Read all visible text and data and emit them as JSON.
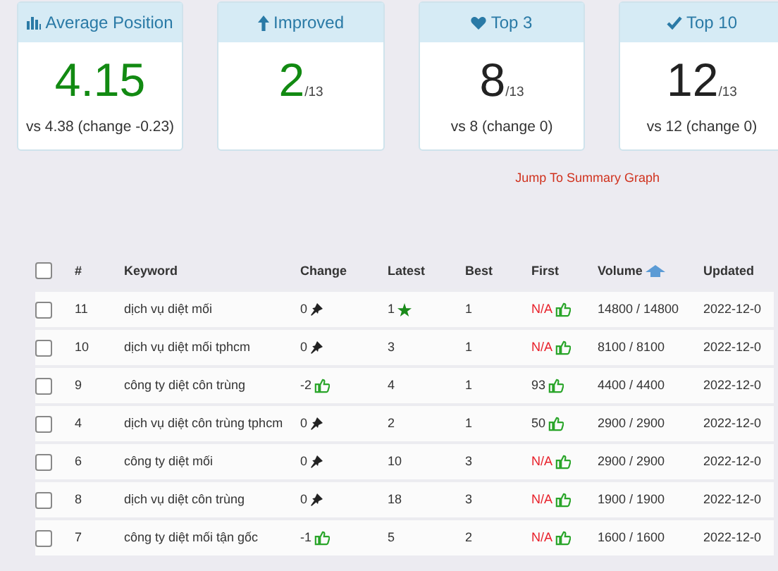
{
  "cards": [
    {
      "title": "Average Position",
      "value": "4.15",
      "color": "#128a12",
      "footer": "vs 4.38 (change -0.23)"
    },
    {
      "title": "Improved",
      "value": "2",
      "suffix": "/13",
      "color": "#128a12"
    },
    {
      "title": "Top 3",
      "value": "8",
      "suffix": "/13",
      "color": "#222222",
      "footer": "vs 8 (change 0)"
    },
    {
      "title": "Top 10",
      "value": "12",
      "suffix": "/13",
      "color": "#222222",
      "footer": "vs 12 (change 0)"
    }
  ],
  "summary_link": "Jump To Summary Graph",
  "table": {
    "select_all_checked": false,
    "columns": [
      "#",
      "Keyword",
      "Change",
      "Latest",
      "Best",
      "First",
      "Volume",
      "Updated"
    ],
    "rows": [
      {
        "checked": false,
        "num": "11",
        "keyword": "dịch vụ diệt mối",
        "change": "0",
        "kind": "pin",
        "latest": "1",
        "latest_star": true,
        "best": "1",
        "first": "N/A",
        "first_missing": true,
        "volume": "14800 / 14800",
        "updated": "2022-12-0"
      },
      {
        "checked": false,
        "num": "10",
        "keyword": "dịch vụ diệt mối tphcm",
        "change": "0",
        "kind": "pin",
        "latest": "3",
        "latest_star": false,
        "best": "1",
        "first": "N/A",
        "first_missing": true,
        "volume": "8100 / 8100",
        "updated": "2022-12-0"
      },
      {
        "checked": false,
        "num": "9",
        "keyword": "công ty diệt côn trùng",
        "change": "-2",
        "kind": "up",
        "latest": "4",
        "latest_star": false,
        "best": "1",
        "first": "93",
        "first_missing": false,
        "volume": "4400 / 4400",
        "updated": "2022-12-0"
      },
      {
        "checked": false,
        "num": "4",
        "keyword": "dịch vụ diệt côn trùng tphcm",
        "change": "0",
        "kind": "pin",
        "latest": "2",
        "latest_star": false,
        "best": "1",
        "first": "50",
        "first_missing": false,
        "volume": "2900 / 2900",
        "updated": "2022-12-0"
      },
      {
        "checked": false,
        "num": "6",
        "keyword": "công ty diệt mối",
        "change": "0",
        "kind": "pin",
        "latest": "10",
        "latest_star": false,
        "best": "3",
        "first": "N/A",
        "first_missing": true,
        "volume": "2900 / 2900",
        "updated": "2022-12-0"
      },
      {
        "checked": false,
        "num": "8",
        "keyword": "dịch vụ diệt côn trùng",
        "change": "0",
        "kind": "pin",
        "latest": "18",
        "latest_star": false,
        "best": "3",
        "first": "N/A",
        "first_missing": true,
        "volume": "1900 / 1900",
        "updated": "2022-12-0"
      },
      {
        "checked": false,
        "num": "7",
        "keyword": "công ty diệt mối tận gốc",
        "change": "-1",
        "kind": "up",
        "latest": "5",
        "latest_star": false,
        "best": "2",
        "first": "N/A",
        "first_missing": true,
        "volume": "1600 / 1600",
        "updated": "2022-12-0"
      }
    ]
  }
}
